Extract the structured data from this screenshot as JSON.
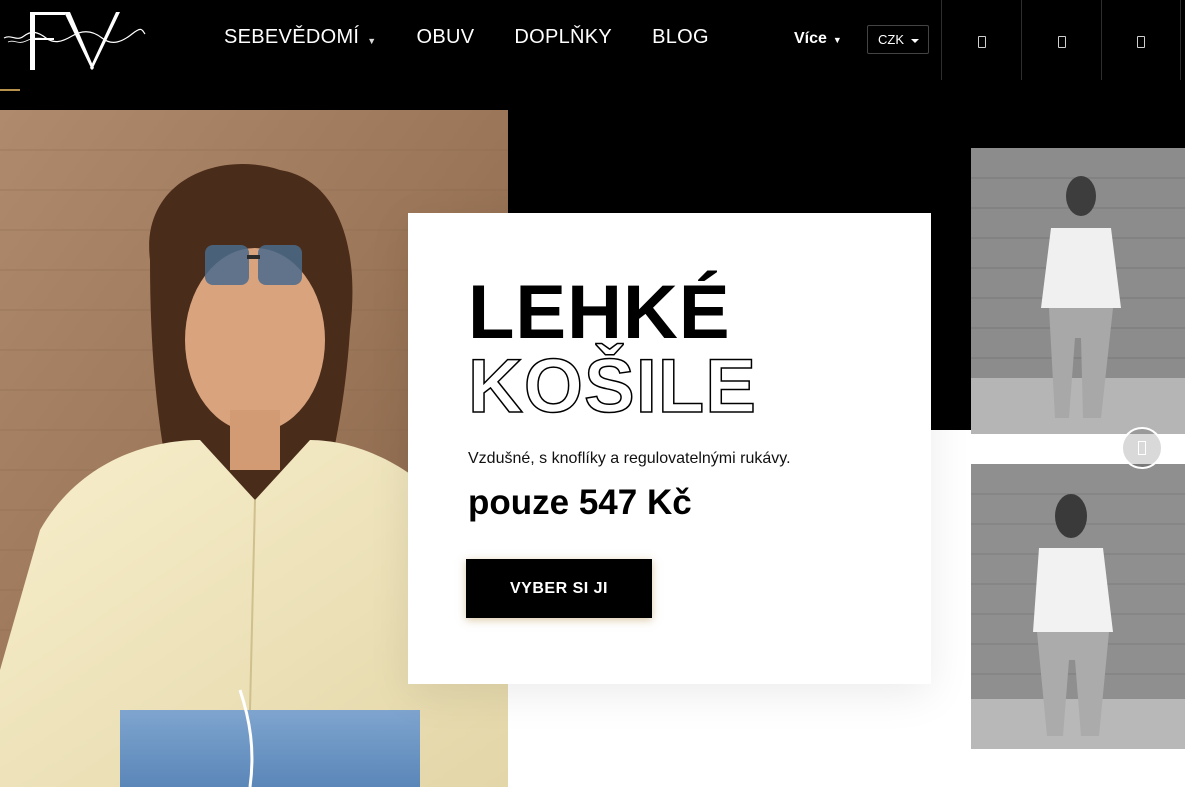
{
  "colors": {
    "header_bg": "#000000",
    "accent_gold": "#b8924d",
    "card_bg": "#ffffff",
    "cta_bg": "#000000"
  },
  "logo": {
    "monogram": "FV",
    "script": "Fashion Victim"
  },
  "nav": {
    "items": [
      {
        "label": "SEBEVĚDOMÍ",
        "has_dropdown": true
      },
      {
        "label": "OBUV"
      },
      {
        "label": "DOPLŇKY"
      },
      {
        "label": "BLOG"
      }
    ],
    "more_label": "Více",
    "currency": "CZK"
  },
  "header_icons": [
    "search-icon",
    "user-icon",
    "cart-icon"
  ],
  "promo": {
    "title": "LEHKÉ",
    "subtitle": "KOŠILE",
    "description": "Vzdušné, s knoflíky a regulovatelnými rukávy.",
    "price": "pouze 547 Kč",
    "cta": "VYBER SI JI"
  },
  "thumbnails_count": 2
}
